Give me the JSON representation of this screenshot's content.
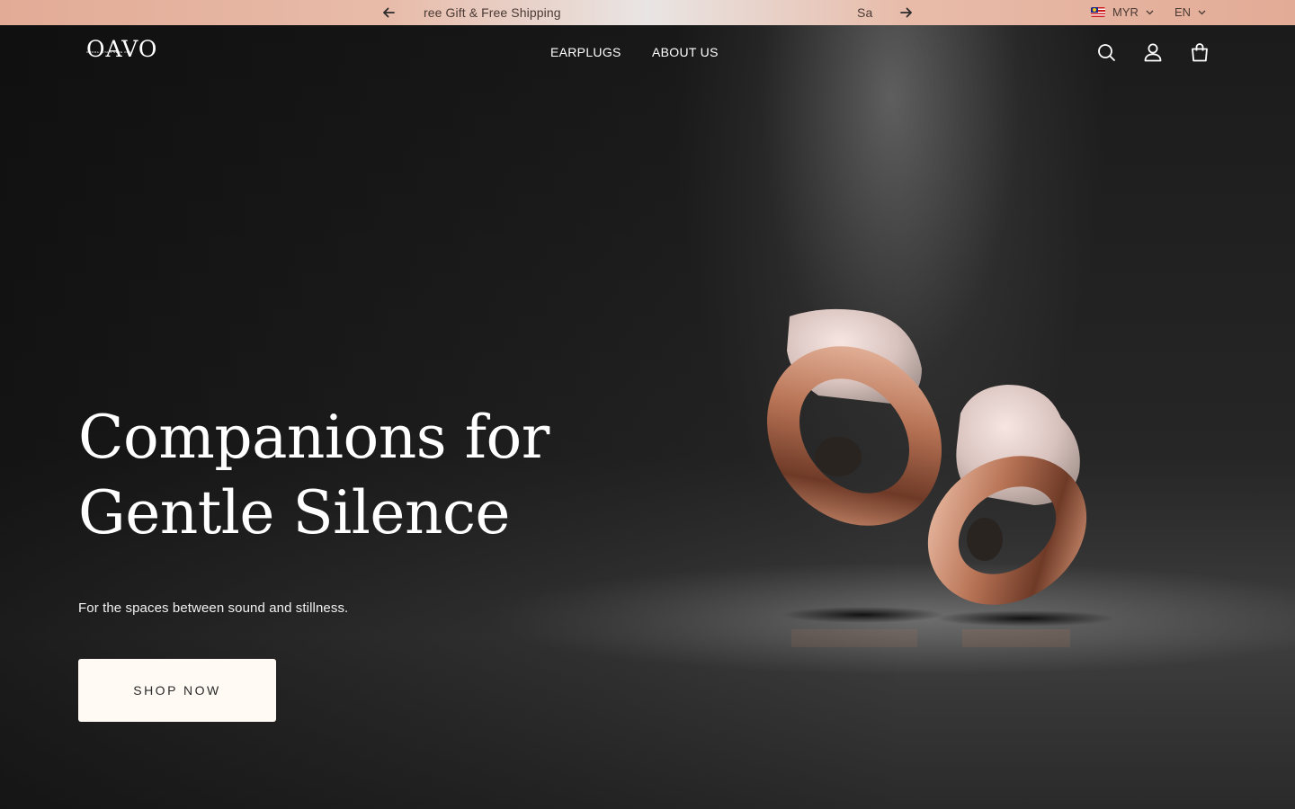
{
  "announcement": {
    "messages": [
      "ree Gift & Free Shipping",
      "Sa"
    ],
    "prev_icon": "arrow-left-icon",
    "next_icon": "arrow-right-icon",
    "currency": "MYR",
    "language": "EN",
    "flag": "malaysia-flag-icon"
  },
  "header": {
    "logo_text": "OAVO",
    "logo_tagline": "OMORA ALTA'S SERE ONA",
    "nav": [
      "EARPLUGS",
      "ABOUT US"
    ],
    "icons": [
      "search-icon",
      "account-icon",
      "cart-icon"
    ]
  },
  "hero": {
    "title_line_1": "Companions for",
    "title_line_2": "Gentle Silence",
    "subtitle": "For the spaces between sound and stillness.",
    "cta_label": "SHOP NOW"
  },
  "colors": {
    "announcement_bg": "#e2ab96",
    "hero_bg": "#1b1b1b",
    "button_bg": "#fffaf4",
    "copper": "#b87355"
  }
}
